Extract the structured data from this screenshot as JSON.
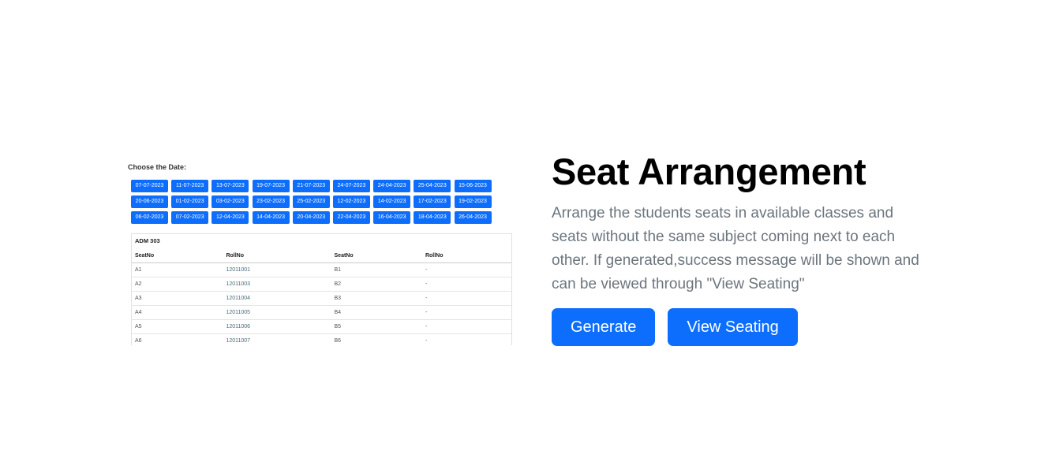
{
  "preview": {
    "label": "Choose the Date:",
    "dates": [
      "07-07-2023",
      "11-07-2023",
      "13-07-2023",
      "19-07-2023",
      "21-07-2023",
      "24-07-2023",
      "24-04-2023",
      "25-04-2023",
      "15-06-2023",
      "20-06-2023",
      "01-02-2023",
      "03-02-2023",
      "23-02-2023",
      "25-02-2023",
      "12-02-2023",
      "14-02-2023",
      "17-02-2023",
      "19-02-2023",
      "06-02-2023",
      "07-02-2023",
      "12-04-2023",
      "14-04-2023",
      "20-04-2023",
      "22-04-2023",
      "16-04-2023",
      "18-04-2023",
      "26-04-2023"
    ],
    "room": "ADM 303",
    "table": {
      "headers": [
        "SeatNo",
        "RollNo",
        "SeatNo",
        "RollNo"
      ],
      "rows": [
        [
          "A1",
          "12011001",
          "B1",
          "-"
        ],
        [
          "A2",
          "12011003",
          "B2",
          "-"
        ],
        [
          "A3",
          "12011004",
          "B3",
          "-"
        ],
        [
          "A4",
          "12011005",
          "B4",
          "-"
        ],
        [
          "A5",
          "12011006",
          "B5",
          "-"
        ],
        [
          "A6",
          "12011007",
          "B6",
          "-"
        ]
      ]
    }
  },
  "hero": {
    "title": "Seat Arrangement",
    "description": "Arrange the students seats in available classes and seats without the same subject coming next to each other. If generated,success message will be shown and can be viewed through \"View Seating\"",
    "generate_label": "Generate",
    "view_label": "View Seating"
  },
  "colors": {
    "primary": "#0d6efd",
    "muted_text": "#6c757d"
  }
}
